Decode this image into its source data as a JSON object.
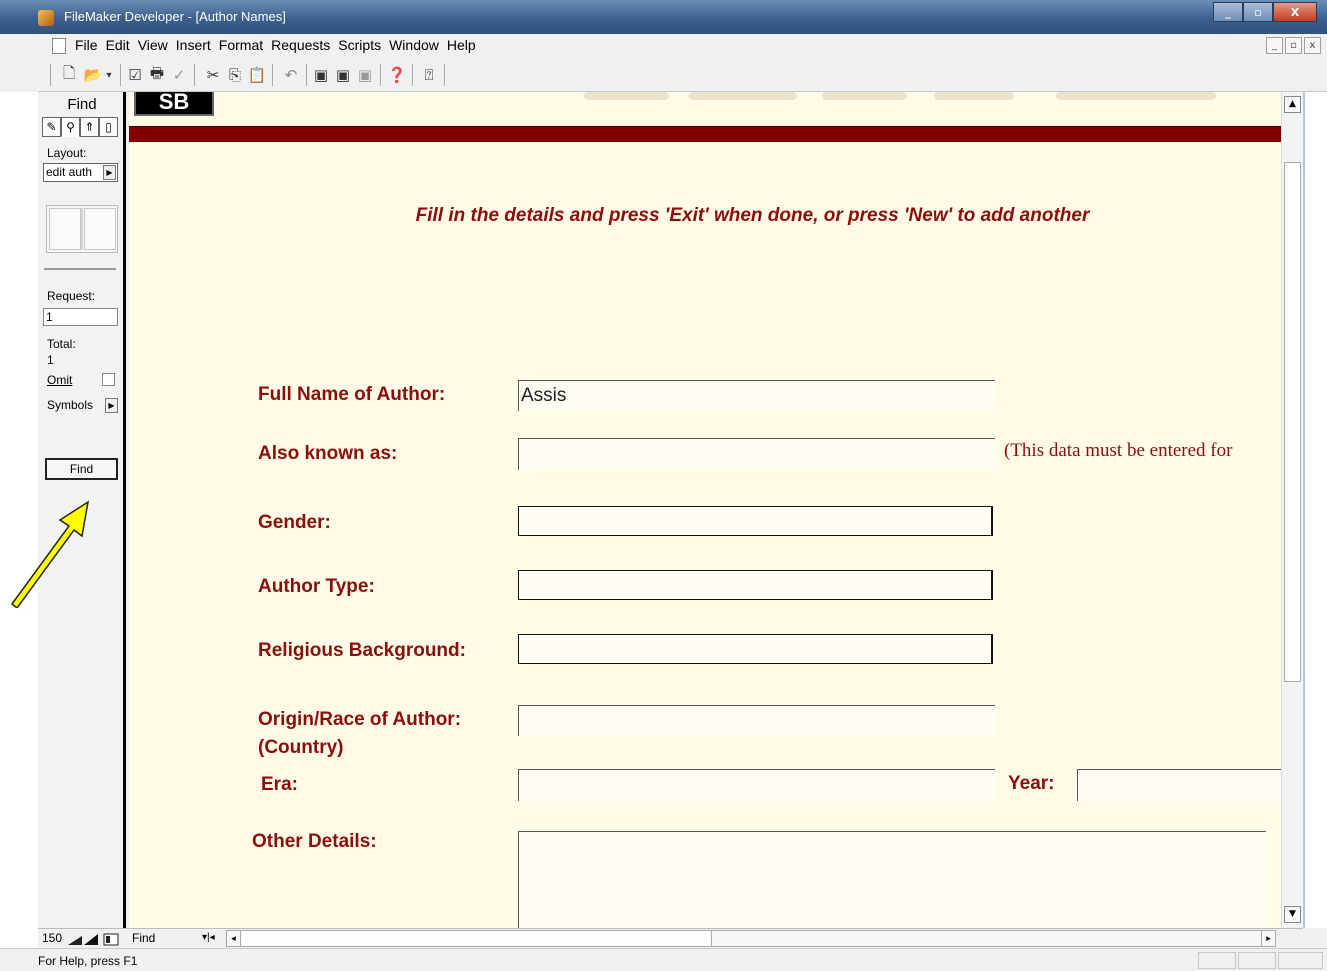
{
  "window": {
    "title": "FileMaker Developer - [Author Names]",
    "min_label": "_",
    "max_label": "▫",
    "close_label": "X"
  },
  "menubar": {
    "items": [
      "File",
      "Edit",
      "View",
      "Insert",
      "Format",
      "Requests",
      "Scripts",
      "Window",
      "Help"
    ],
    "mdi": [
      "_",
      "▫",
      "x"
    ]
  },
  "toolbar": {
    "icons": [
      "new-file-icon",
      "open-folder-icon",
      "dropdown-icon",
      "checklist-icon",
      "printer-icon",
      "spellcheck-icon",
      "cut-icon",
      "copy-icon",
      "paste-icon",
      "undo-icon",
      "browse-mode-icon",
      "find-mode-icon",
      "layout-mode-icon",
      "help-pointer-icon",
      "help-icon"
    ]
  },
  "status_area": {
    "mode": "Find",
    "layout_label": "Layout:",
    "layout_value": "edit auth",
    "request_label": "Request:",
    "request_value": "1",
    "total_label": "Total:",
    "total_value": "1",
    "omit_label": "Omit",
    "symbols_label": "Symbols",
    "find_button": "Find"
  },
  "form": {
    "logo_text": "SB",
    "instruction": "Fill in the details and press 'Exit' when done, or press 'New' to add another",
    "full_name_label": "Full Name of Author:",
    "full_name_value": "Assis",
    "aka_label": "Also known as:",
    "aka_note": "(This data must be entered for",
    "gender_label": "Gender:",
    "author_type_label": "Author Type:",
    "religious_label": "Religious Background:",
    "origin_label_1": "Origin/Race of Author:",
    "origin_label_2": "(Country)",
    "era_label": "Era:",
    "year_label": "Year:",
    "other_label": "Other Details:"
  },
  "bottom": {
    "zoom": "150",
    "mode": "Find"
  },
  "statusbar": {
    "help": "For Help, press F1"
  },
  "colors": {
    "accent_red": "#820000",
    "label_red": "#8b0e0e",
    "content_bg": "#fffbe6",
    "annotation_arrow": "#ffff00"
  }
}
